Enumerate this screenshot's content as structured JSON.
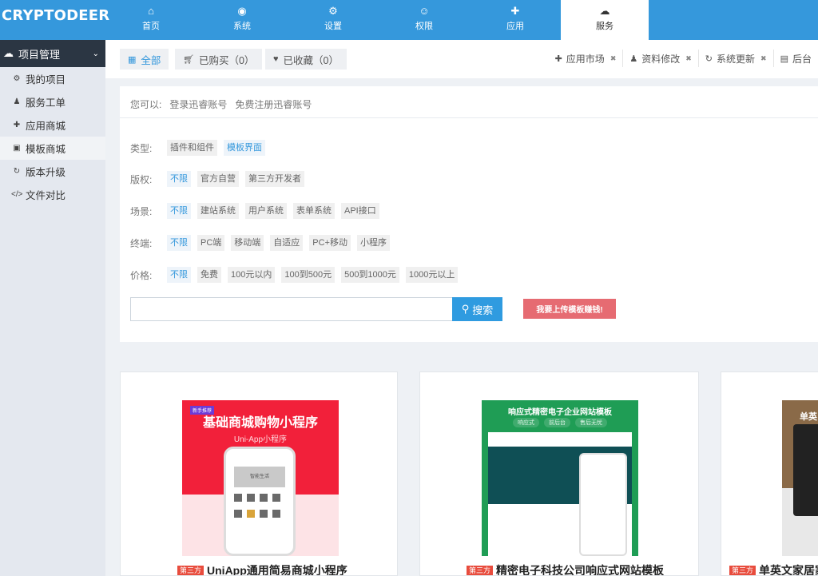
{
  "app": {
    "logo": "CRYPTODEER"
  },
  "topnav": [
    {
      "icon": "⌂",
      "label": "首页"
    },
    {
      "icon": "◉",
      "label": "系统"
    },
    {
      "icon": "⚙",
      "label": "设置"
    },
    {
      "icon": "☺",
      "label": "权限"
    },
    {
      "icon": "✚",
      "label": "应用"
    },
    {
      "icon": "☁",
      "label": "服务"
    }
  ],
  "sidebar": {
    "header": "项目管理",
    "items": [
      {
        "icon": "⚙",
        "label": "我的项目"
      },
      {
        "icon": "♟",
        "label": "服务工单"
      },
      {
        "icon": "✚",
        "label": "应用商城"
      },
      {
        "icon": "▣",
        "label": "模板商城"
      },
      {
        "icon": "↻",
        "label": "版本升级"
      },
      {
        "icon": "</>",
        "label": "文件对比"
      }
    ]
  },
  "tabs": {
    "all": "全部",
    "bought": "已购买（0）",
    "favorited": "已收藏（0）"
  },
  "quick_tabs": [
    {
      "icon": "✚",
      "label": "应用市场"
    },
    {
      "icon": "♟",
      "label": "资料修改"
    },
    {
      "icon": "↻",
      "label": "系统更新"
    },
    {
      "icon": "▤",
      "label": "后台"
    }
  ],
  "hint": {
    "prefix": "您可以:",
    "login": "登录迅睿账号",
    "register": "免费注册迅睿账号"
  },
  "filters": {
    "type": {
      "label": "类型:",
      "options": [
        "插件和组件",
        "模板界面"
      ],
      "selected": 1
    },
    "copyright": {
      "label": "版权:",
      "options": [
        "不限",
        "官方自营",
        "第三方开发者"
      ],
      "selected": 0
    },
    "scene": {
      "label": "场景:",
      "options": [
        "不限",
        "建站系统",
        "用户系统",
        "表单系统",
        "API接口"
      ],
      "selected": 0
    },
    "terminal": {
      "label": "终端:",
      "options": [
        "不限",
        "PC端",
        "移动端",
        "自适应",
        "PC+移动",
        "小程序"
      ],
      "selected": 0
    },
    "price": {
      "label": "价格:",
      "options": [
        "不限",
        "免费",
        "100元以内",
        "100到500元",
        "500到1000元",
        "1000元以上"
      ],
      "selected": 0
    }
  },
  "search": {
    "placeholder": "",
    "button": "搜索",
    "upload": "我要上传模板赚钱!"
  },
  "cards": [
    {
      "badge": "第三方",
      "title": "UniApp通用简易商城小程序",
      "thumb_title": "基础商城购物小程序",
      "thumb_sub": "Uni-App小程序",
      "thumb_tag": "新手推荐",
      "thumb_banner": "智能生活"
    },
    {
      "badge": "第三方",
      "title": "精密电子科技公司响应式网站模板",
      "thumb_title": "响应式精密电子企业网站模板",
      "thumb_pills": [
        "响应式",
        "前后台",
        "售后无忧"
      ]
    },
    {
      "badge": "第三方",
      "title": "单英文家居家",
      "thumb_title": "单英"
    }
  ]
}
